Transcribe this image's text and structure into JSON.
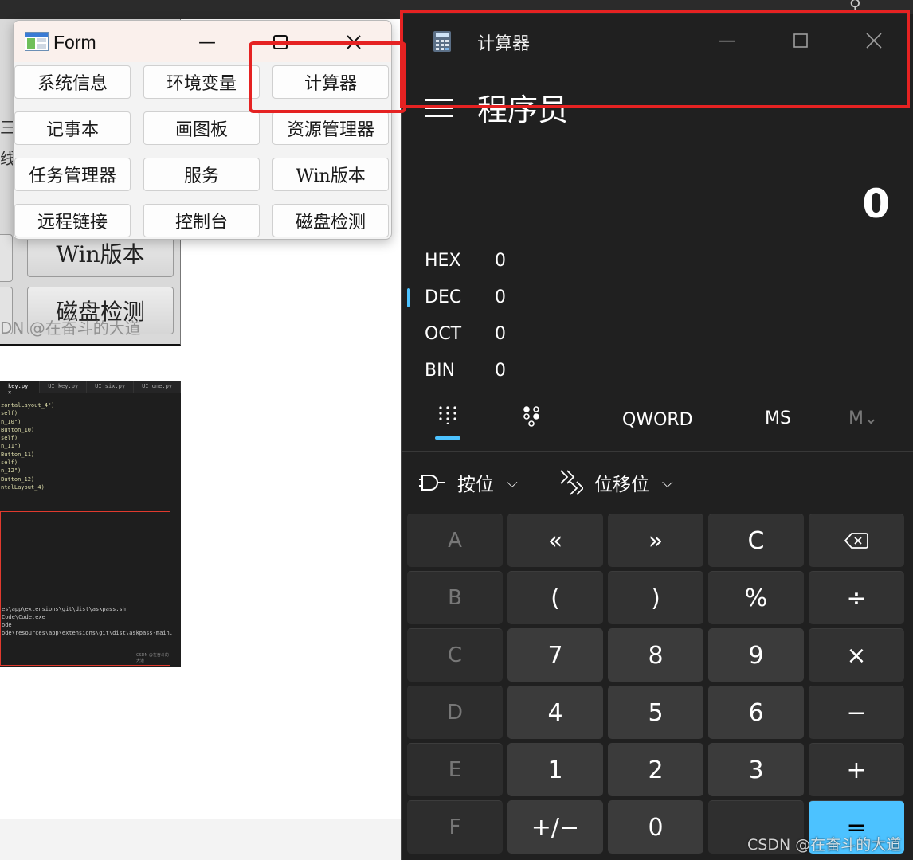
{
  "background": {
    "win1_buttons": [
      "Win版本",
      "磁盘检测"
    ],
    "win1_side": [
      "三",
      "线"
    ],
    "watermark1": "DN @在奋斗的大道",
    "code_tabs": [
      "key.py ×",
      "UI_key.py",
      "UI_six.py",
      "UI_one.py"
    ],
    "code_lines": [
      "zontalLayout_4\")",
      "self)",
      "n_10\")",
      "Button_10)",
      "self)",
      "n_11\")",
      "Button_11)",
      "self)",
      "n_12\")",
      "Button_12)",
      "ntalLayout_4)"
    ],
    "terminal_lines": [
      "es\\app\\extensions\\git\\dist\\askpass.sh",
      "Code\\Code.exe",
      "ode",
      "ode\\resources\\app\\extensions\\git\\dist\\askpass-main."
    ],
    "terminal_watermark": "CSDN @在奋斗的大道"
  },
  "form": {
    "title": "Form",
    "buttons": [
      "系统信息",
      "环境变量",
      "计算器",
      "记事本",
      "画图板",
      "资源管理器",
      "任务管理器",
      "服务",
      "Win版本",
      "远程链接",
      "控制台",
      "磁盘检测"
    ]
  },
  "calculator": {
    "title": "计算器",
    "mode": "程序员",
    "display": "0",
    "bases": [
      {
        "name": "HEX",
        "value": "0"
      },
      {
        "name": "DEC",
        "value": "0"
      },
      {
        "name": "OCT",
        "value": "0"
      },
      {
        "name": "BIN",
        "value": "0"
      }
    ],
    "selected_base": "DEC",
    "tabs": {
      "word_size": "QWORD",
      "ms": "MS",
      "m": "M⌄"
    },
    "ops": {
      "bitwise": "按位",
      "shift": "位移位"
    },
    "keys": [
      [
        "A",
        "«",
        "»",
        "C",
        "⌫"
      ],
      [
        "B",
        "(",
        ")",
        "%",
        "÷"
      ],
      [
        "C",
        "7",
        "8",
        "9",
        "×"
      ],
      [
        "D",
        "4",
        "5",
        "6",
        "−"
      ],
      [
        "E",
        "1",
        "2",
        "3",
        "+"
      ],
      [
        "F",
        "+/−",
        "0",
        "",
        "="
      ]
    ]
  },
  "watermark": "CSDN @在奋斗的大道",
  "colors": {
    "accent": "#4cc2ff",
    "highlight": "#e52222",
    "calc_bg": "#202020"
  }
}
